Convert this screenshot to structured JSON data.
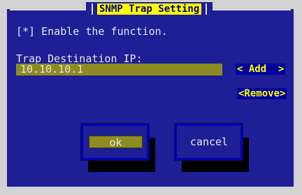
{
  "dialog": {
    "title": "SNMP Trap Setting"
  },
  "enable": {
    "label": "[*] Enable the function."
  },
  "trap": {
    "label": "Trap Destination IP:",
    "value": "10.10.10.1"
  },
  "buttons": {
    "add": "< Add  >",
    "remove": "<Remove>",
    "ok": "ok",
    "cancel": "cancel"
  },
  "colors": {
    "background": "#1e1e96",
    "title_bg": "#ffff00",
    "field_bg": "#8c8c22",
    "text": "#e6e6e6",
    "accent_text": "#ffff00"
  }
}
